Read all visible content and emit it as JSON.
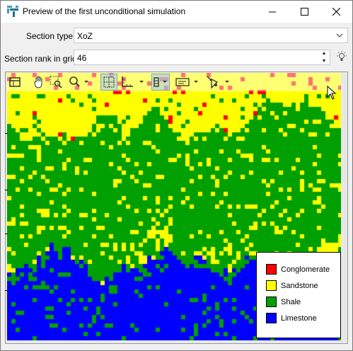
{
  "window": {
    "title": "Preview of the first unconditional simulation"
  },
  "controls": {
    "section_type_label": "Section type",
    "section_type_value": "XoZ",
    "section_rank_label": "Section rank in grid",
    "section_rank_value": "46"
  },
  "legend": [
    {
      "label": "Conglomerate",
      "color": "#ff0000"
    },
    {
      "label": "Sandstone",
      "color": "#ffff00"
    },
    {
      "label": "Shale",
      "color": "#00a000"
    },
    {
      "label": "Limestone",
      "color": "#0000ff"
    }
  ],
  "toolbar_icons": [
    "window-icon",
    "pan-hand-icon",
    "zoom-box-icon",
    "zoom-icon",
    "grid-icon",
    "ruler-icon",
    "layers-icon",
    "label-icon",
    "export-icon"
  ],
  "colors": {
    "titlebar": "#ffffff",
    "background": "#f0f0f0"
  }
}
